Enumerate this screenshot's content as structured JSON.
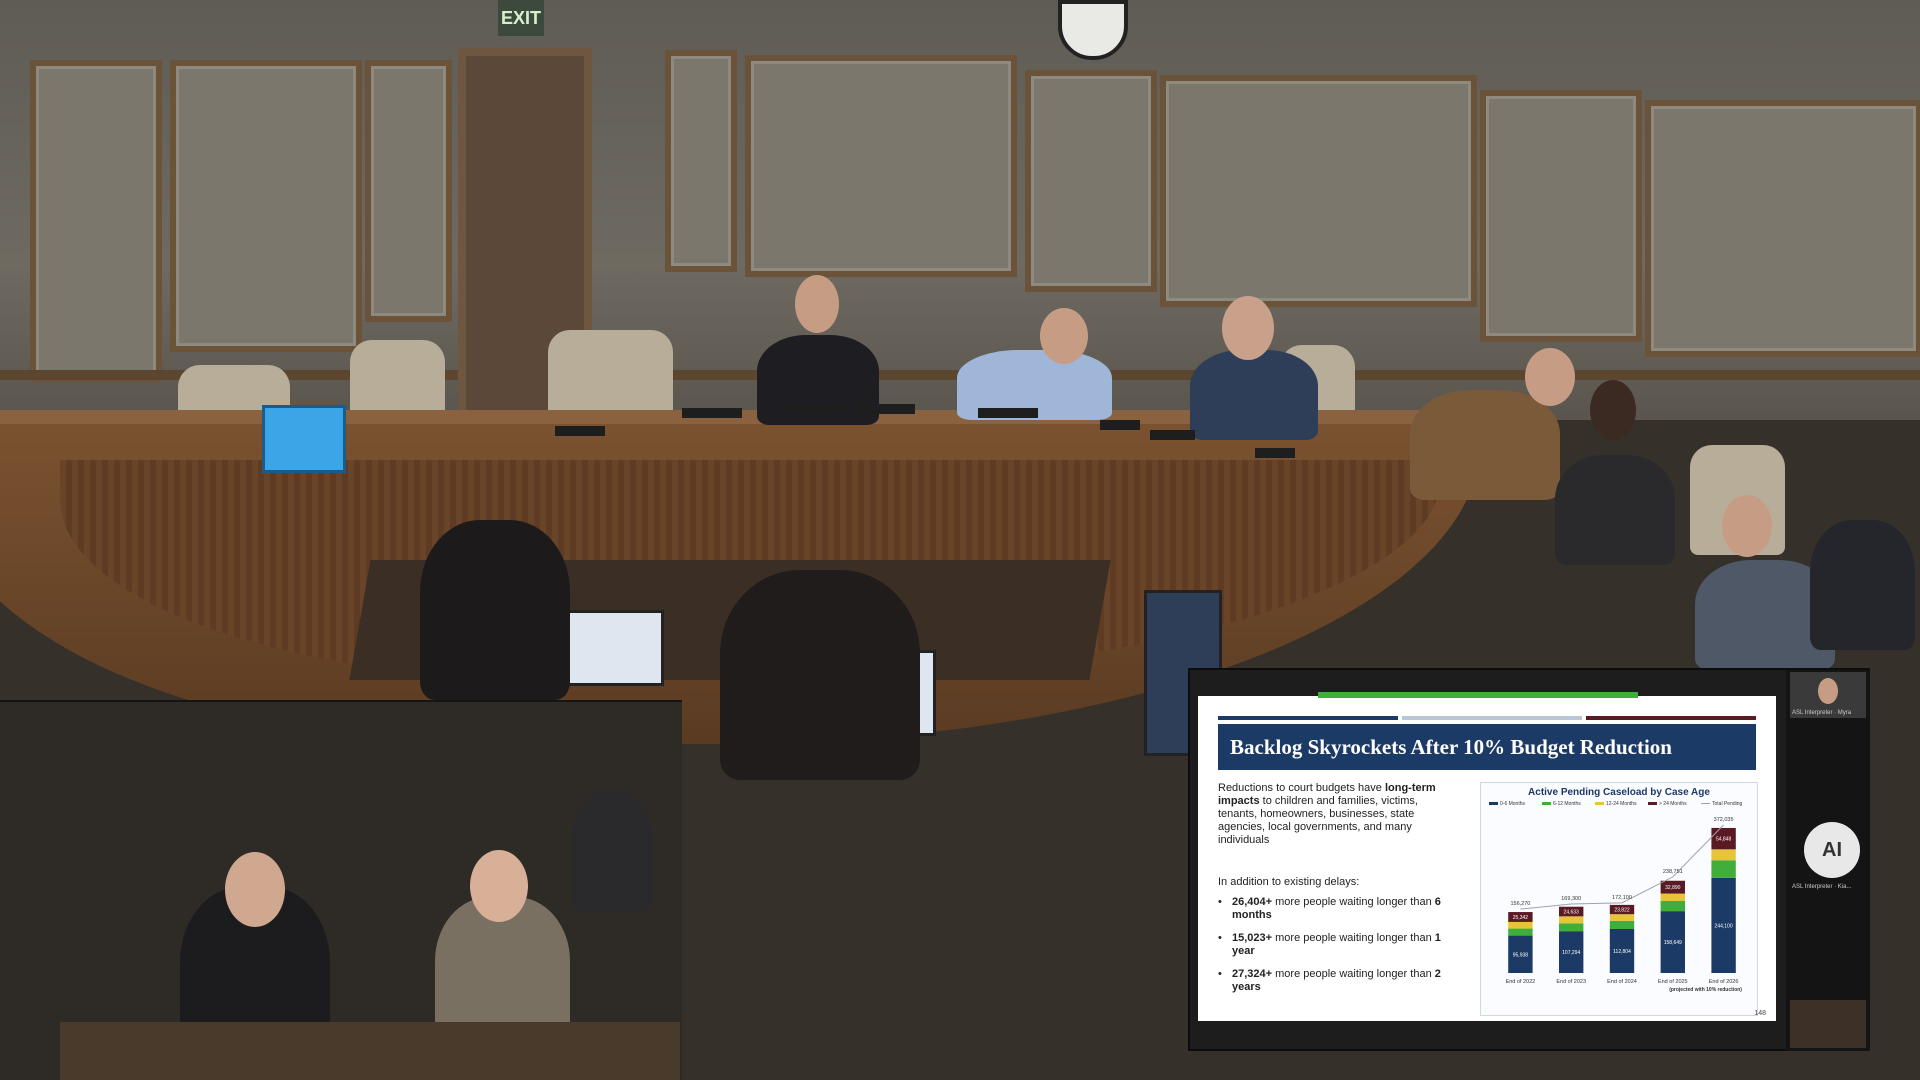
{
  "room": {
    "exit_sign": "EXIT"
  },
  "slide": {
    "title": "Backlog Skyrockets After 10% Budget Reduction",
    "intro_prefix": "Reductions to court budgets have ",
    "intro_bold": "long-term impacts",
    "intro_suffix": " to children and families, victims, tenants, homeowners, businesses, state agencies, local governments, and many individuals",
    "sub_heading": "In addition to existing delays:",
    "bullets": [
      {
        "bold": "26,404+",
        "text": " more people waiting longer than ",
        "bold2": "6 months"
      },
      {
        "bold": "15,023+",
        "text": " more people waiting longer than ",
        "bold2": "1 year"
      },
      {
        "bold": "27,324+",
        "text": " more people waiting longer than ",
        "bold2": "2 years"
      }
    ],
    "page_number": "148"
  },
  "chart_data": {
    "type": "bar",
    "title": "Active Pending Caseload by Case Age",
    "categories": [
      "End of 2022",
      "End of 2023",
      "End of 2024",
      "End of 2025",
      "End of 2026"
    ],
    "category_note": "(projected with 10% reduction)",
    "legend": [
      "0-6 Months",
      "6-12 Months",
      "12-24 Months",
      "> 24 Months",
      "Total Pending"
    ],
    "series": [
      {
        "name": "0-6 Months",
        "color": "#1c3a66",
        "values": [
          95938,
          107294,
          112804,
          158649,
          244100
        ],
        "labels": [
          "95,938",
          "107,294",
          "112,804",
          "158,649",
          "244,100"
        ]
      },
      {
        "name": "6-12 Months",
        "color": "#3fae3a",
        "values": [
          18000,
          20000,
          21000,
          26000,
          45000
        ],
        "labels": [
          "",
          "",
          "",
          "",
          ""
        ]
      },
      {
        "name": "12-24 Months",
        "color": "#e8c43a",
        "values": [
          17000,
          18000,
          17000,
          19000,
          28000
        ],
        "labels": [
          "",
          "",
          "",
          "",
          ""
        ]
      },
      {
        "name": "> 24 Months",
        "color": "#5a1a24",
        "values": [
          25342,
          24633,
          23822,
          32890,
          54848
        ],
        "labels": [
          "25,342",
          "24,633",
          "23,822",
          "32,890",
          "54,848"
        ]
      }
    ],
    "totals": [
      156270,
      169300,
      172100,
      238751,
      372035
    ],
    "total_labels": [
      "156,270",
      "169,300",
      "172,100",
      "238,751",
      "372,035"
    ],
    "ylim": [
      0,
      400000
    ]
  },
  "participants": {
    "tile_top_label": "ASL Interpreter · Myra",
    "avatar_initials": "AI",
    "avatar_label": "ASL Interpreter · Kia..."
  },
  "colors": {
    "slide_navy": "#1c3a66",
    "slide_green": "#3fae3a",
    "slide_maroon": "#5a1a24"
  }
}
